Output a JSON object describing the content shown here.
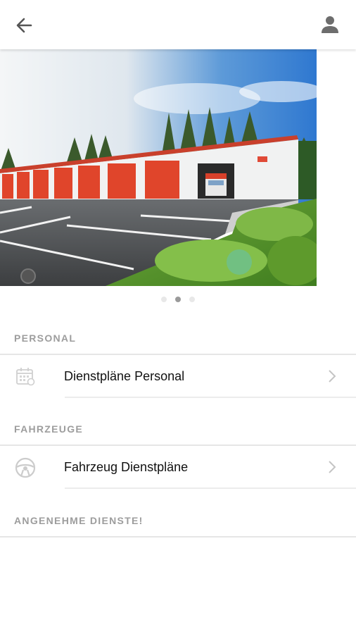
{
  "header": {
    "back_icon": "arrow-left-icon",
    "profile_icon": "person-icon"
  },
  "carousel": {
    "page_count": 3,
    "active_index": 1
  },
  "sections": {
    "personal": {
      "title": "PERSONAL",
      "item_label": "Dienstpläne Personal",
      "item_icon": "calendar-icon"
    },
    "fahrzeuge": {
      "title": "FAHRZEUGE",
      "item_label": "Fahrzeug Dienstpläne",
      "item_icon": "steering-wheel-icon"
    },
    "footer_message": "ANGENEHME DIENSTE!"
  },
  "colors": {
    "garage_door_red": "#e0452b",
    "section_header_grey": "#9d9d9d"
  }
}
